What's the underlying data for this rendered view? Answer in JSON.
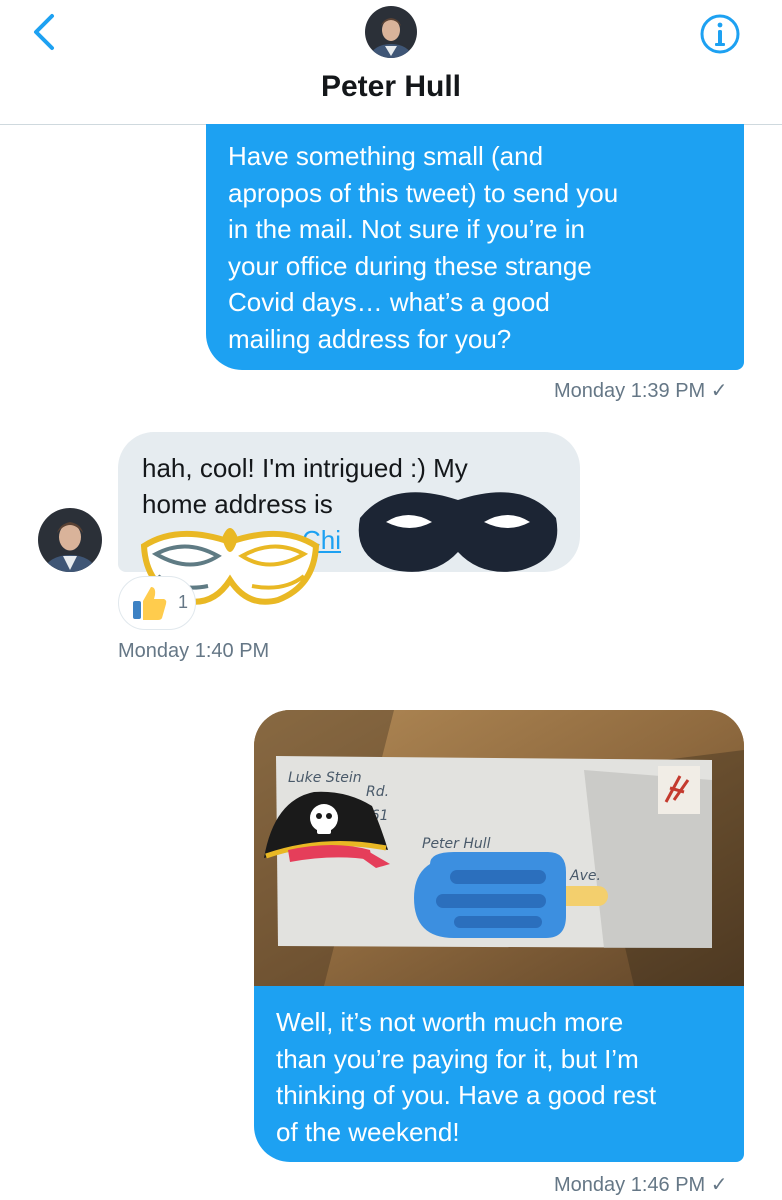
{
  "header": {
    "title": "Peter Hull"
  },
  "messages": [
    {
      "direction": "outgoing",
      "lines": [
        "Have something small (and",
        "apropos of this tweet) to send you",
        "in the mail. Not sure if you’re in",
        "your office during these strange",
        "Covid days… what’s a good",
        "mailing address for you?"
      ],
      "time": "Monday 1:39 PM ✓"
    },
    {
      "direction": "incoming",
      "lines": [
        "hah, cool! I'm intrigued :) My",
        "home address is"
      ],
      "link_fragment": "Chi",
      "time": "Monday 1:40 PM",
      "reaction": {
        "emoji": "👍",
        "count": "1"
      }
    },
    {
      "direction": "outgoing",
      "photo": {
        "envelope_lines": [
          "Luke Stein",
          "Rd.",
          "02461",
          "Peter Hull",
          "Ave."
        ]
      },
      "lines": [
        "Well, it’s not worth much more",
        "than you’re paying for it, but I’m",
        "thinking of you. Have a good rest",
        "of the weekend!"
      ],
      "time": "Monday 1:46 PM ✓"
    }
  ],
  "icons": [
    "chevron-left-icon",
    "info-icon",
    "thumbs-up-icon",
    "masquerade-mask-icon",
    "eye-mask-icon",
    "pirate-hat-icon",
    "popsicle-icon"
  ],
  "colors": {
    "accent": "#1da1f2",
    "incoming_bubble": "#e6ecf0",
    "timestamp": "#657786"
  }
}
